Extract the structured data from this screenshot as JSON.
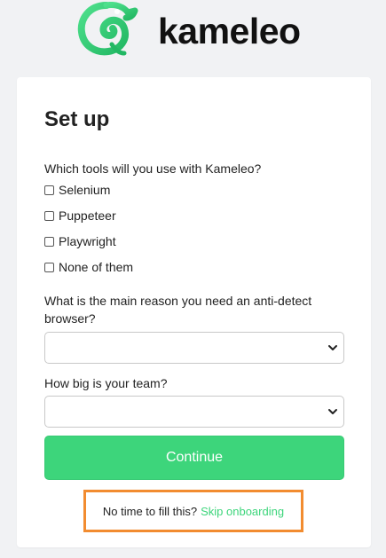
{
  "brand": {
    "name": "kameleo",
    "logo_icon": "chameleon-logo-icon",
    "logo_color": "#3dd57b"
  },
  "form": {
    "title": "Set up",
    "tools_question": "Which tools will you use with Kameleo?",
    "tools_options": [
      {
        "label": "Selenium",
        "checked": false
      },
      {
        "label": "Puppeteer",
        "checked": false
      },
      {
        "label": "Playwright",
        "checked": false
      },
      {
        "label": "None of them",
        "checked": false
      }
    ],
    "reason_question": "What is the main reason you need an anti-detect browser?",
    "reason_value": "",
    "team_question": "How big is your team?",
    "team_value": "",
    "select_icon": "chevron-down-icon",
    "continue_label": "Continue",
    "skip_prompt": "No time to fill this?",
    "skip_link": "Skip onboarding"
  },
  "colors": {
    "accent": "#3dd57b",
    "highlight": "#f28c30"
  }
}
